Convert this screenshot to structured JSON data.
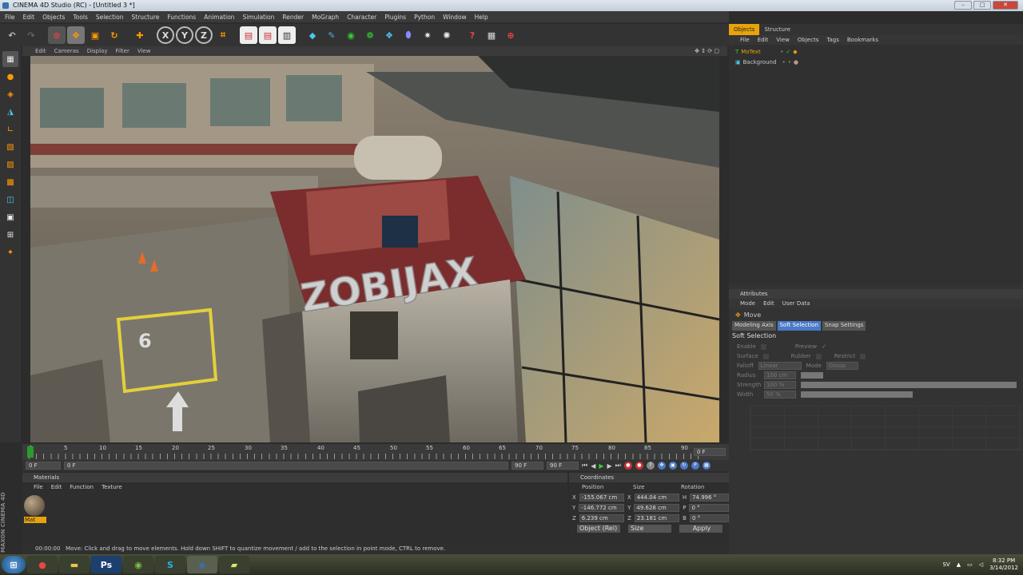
{
  "window": {
    "title": "CINEMA 4D Studio (RC) - [Untitled 3 *]",
    "controls": [
      "–",
      "□",
      "✕"
    ]
  },
  "menu": [
    "File",
    "Edit",
    "Objects",
    "Tools",
    "Selection",
    "Structure",
    "Functions",
    "Animation",
    "Simulation",
    "Render",
    "MoGraph",
    "Character",
    "Plugins",
    "Python",
    "Window",
    "Help"
  ],
  "viewport": {
    "menu": [
      "Edit",
      "Cameras",
      "Display",
      "Filter",
      "View"
    ],
    "scene_text": "ZOBIJAX"
  },
  "timeline": {
    "ruler": [
      "0",
      "5",
      "10",
      "15",
      "20",
      "25",
      "30",
      "35",
      "40",
      "45",
      "50",
      "55",
      "60",
      "65",
      "70",
      "75",
      "80",
      "85",
      "90"
    ],
    "end_label": "0 F",
    "start_field": "0 F",
    "min_field": "0 F",
    "max_field": "90 F",
    "end_field": "90 F"
  },
  "materials": {
    "title": "Materials",
    "menu": [
      "File",
      "Edit",
      "Function",
      "Texture"
    ],
    "item_label": "Mat"
  },
  "coordinates": {
    "title": "Coordinates",
    "headers": [
      "Position",
      "Size",
      "Rotation"
    ],
    "rows": [
      {
        "axis": "X",
        "pos": "-155.067 cm",
        "size_axis": "X",
        "size": "444.04 cm",
        "rot_axis": "H",
        "rot": "74.996 °"
      },
      {
        "axis": "Y",
        "pos": "-146.772 cm",
        "size_axis": "Y",
        "size": "49.628 cm",
        "rot_axis": "P",
        "rot": "0 °"
      },
      {
        "axis": "Z",
        "pos": "6.239 cm",
        "size_axis": "Z",
        "size": "23.181 cm",
        "rot_axis": "B",
        "rot": "0 °"
      }
    ],
    "mode_select": "Object (Rel)",
    "size_select": "Size",
    "apply_label": "Apply"
  },
  "status": {
    "time": "00:00:00",
    "message": "Move: Click and drag to move elements. Hold down SHIFT to quantize movement / add to the selection in point mode, CTRL to remove."
  },
  "objects_panel": {
    "tabs": [
      "Objects",
      "Structure"
    ],
    "menu": [
      "File",
      "Edit",
      "View",
      "Objects",
      "Tags",
      "Bookmarks"
    ],
    "items": [
      "MoText",
      "Background"
    ]
  },
  "attributes_panel": {
    "title": "Attributes",
    "menu": [
      "Mode",
      "Edit",
      "User Data"
    ],
    "tool_name": "Move",
    "subtabs": [
      "Modeling Axis",
      "Soft Selection",
      "Snap Settings"
    ],
    "section": "Soft Selection",
    "labels": {
      "enable": "Enable",
      "preview": "Preview",
      "surface": "Surface",
      "rubber": "Rubber",
      "restrict": "Restrict",
      "falloff": "Falloff",
      "falloff_value": "Linear",
      "mode": "Mode",
      "mode_value": "Group",
      "radius": "Radius",
      "radius_value": "100 cm",
      "strength": "Strength",
      "strength_value": "100 %",
      "width": "Width",
      "width_value": "50 %"
    }
  },
  "taskbar": {
    "lang": "SV",
    "time": "8:32 PM",
    "date": "3/14/2012"
  },
  "sidebar_brand": "MAXON CINEMA 4D",
  "colors": {
    "accent": "#e8a30c",
    "selection": "#4a7ac8"
  }
}
